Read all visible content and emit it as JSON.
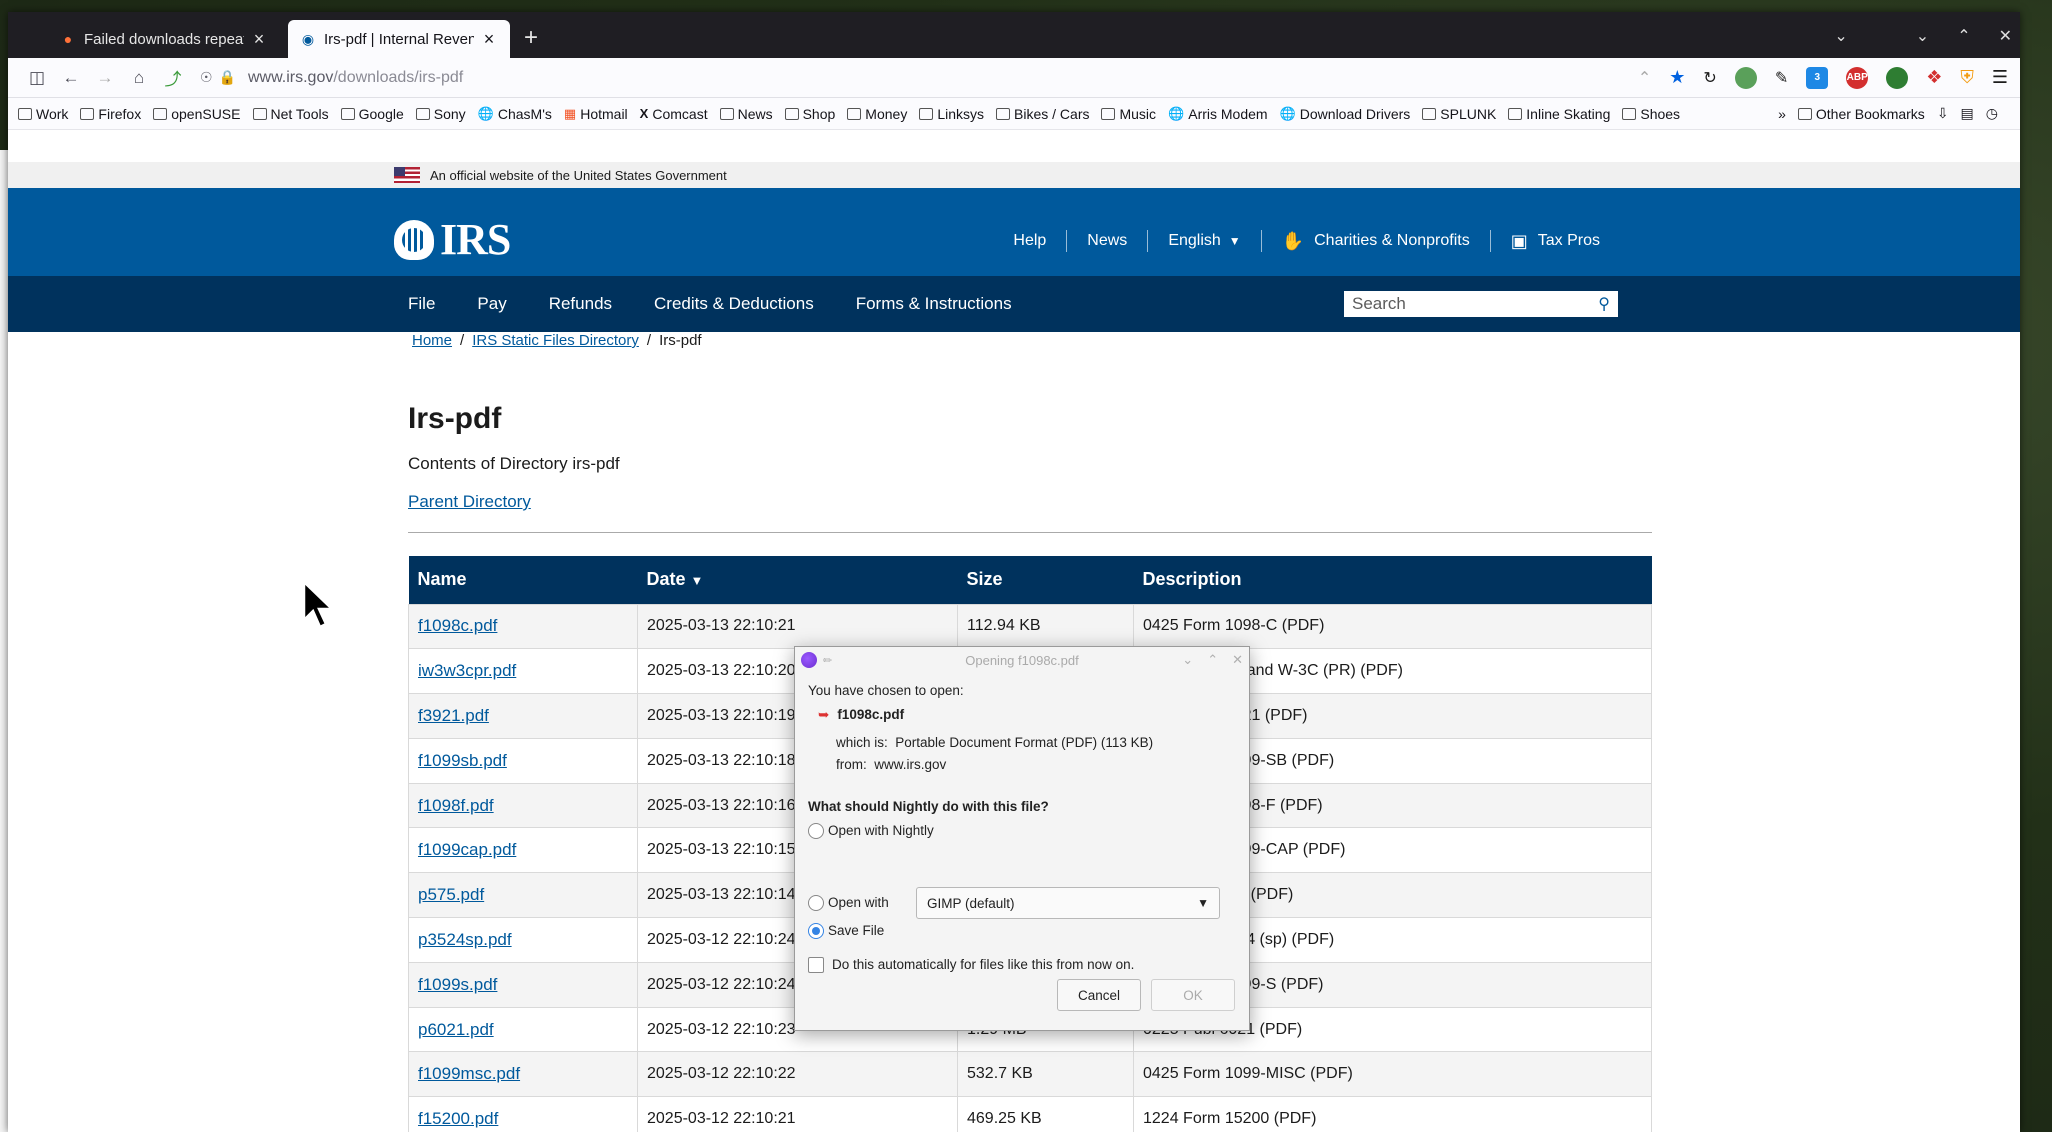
{
  "tabs": [
    {
      "title": "Failed downloads repeated",
      "active": false
    },
    {
      "title": "Irs-pdf | Internal Revenue",
      "active": true
    }
  ],
  "url": {
    "host": "www.irs.gov",
    "path": "/downloads/irs-pdf"
  },
  "extension_badge": "3",
  "bookmarks": [
    "Work",
    "Firefox",
    "openSUSE",
    "Net Tools",
    "Google",
    "Sony",
    "ChasM's",
    "Hotmail",
    "Comcast",
    "News",
    "Shop",
    "Money",
    "Linksys",
    "Bikes / Cars",
    "Music",
    "Arris Modem",
    "Download Drivers",
    "SPLUNK",
    "Inline Skating",
    "Shoes"
  ],
  "other_bookmarks": "Other Bookmarks",
  "gov_banner": "An official website of the United States Government",
  "logo_text": "IRS",
  "utility_nav": [
    "Help",
    "News",
    "English",
    "Charities & Nonprofits",
    "Tax Pros"
  ],
  "main_nav": [
    "File",
    "Pay",
    "Refunds",
    "Credits & Deductions",
    "Forms & Instructions"
  ],
  "search_placeholder": "Search",
  "breadcrumb": {
    "home": "Home",
    "static": "IRS Static Files Directory",
    "current": "Irs-pdf",
    "separator": "/"
  },
  "page": {
    "title": "Irs-pdf",
    "subtitle": "Contents of Directory irs-pdf",
    "parent_link": "Parent Directory"
  },
  "table": {
    "headers": {
      "name": "Name",
      "date": "Date",
      "size": "Size",
      "description": "Description"
    },
    "rows": [
      {
        "name": "f1098c.pdf",
        "date": "2025-03-13 22:10:21",
        "size": "112.94 KB",
        "description": "0425 Form 1098-C (PDF)"
      },
      {
        "name": "iw3w3cpr.pdf",
        "date": "2025-03-13 22:10:20",
        "size": "",
        "description": "0125 Inst W-3 and W-3C (PR) (PDF)"
      },
      {
        "name": "f3921.pdf",
        "date": "2025-03-13 22:10:19",
        "size": "",
        "description": "0425 Form 3921 (PDF)"
      },
      {
        "name": "f1099sb.pdf",
        "date": "2025-03-13 22:10:18",
        "size": "",
        "description": "0425 Form 1099-SB (PDF)"
      },
      {
        "name": "f1098f.pdf",
        "date": "2025-03-13 22:10:16",
        "size": "",
        "description": "0425 Form 1098-F (PDF)"
      },
      {
        "name": "f1099cap.pdf",
        "date": "2025-03-13 22:10:15",
        "size": "",
        "description": "0425 Form 1099-CAP (PDF)"
      },
      {
        "name": "p575.pdf",
        "date": "2025-03-13 22:10:14",
        "size": "",
        "description": "0225 Publ 575 (PDF)"
      },
      {
        "name": "p3524sp.pdf",
        "date": "2025-03-12 22:10:24",
        "size": "",
        "description": "0225 Publ 3524 (sp) (PDF)"
      },
      {
        "name": "f1099s.pdf",
        "date": "2025-03-12 22:10:24",
        "size": "",
        "description": "0425 Form 1099-S (PDF)"
      },
      {
        "name": "p6021.pdf",
        "date": "2025-03-12 22:10:23",
        "size": "1.29 MB",
        "description": "0225 Publ 6021 (PDF)"
      },
      {
        "name": "f1099msc.pdf",
        "date": "2025-03-12 22:10:22",
        "size": "532.7 KB",
        "description": "0425 Form 1099-MISC (PDF)"
      },
      {
        "name": "f15200.pdf",
        "date": "2025-03-12 22:10:21",
        "size": "469.25 KB",
        "description": "1224 Form 15200 (PDF)"
      }
    ]
  },
  "dialog": {
    "title": "Opening f1098c.pdf",
    "chosen": "You have chosen to open:",
    "filename": "f1098c.pdf",
    "which_is_label": "which is:",
    "which_is_value": "Portable Document Format (PDF) (113 KB)",
    "from_label": "from:",
    "from_value": "www.irs.gov",
    "question": "What should Nightly do with this file?",
    "opt_open_nightly": "Open with Nightly",
    "opt_open_with": "Open with",
    "app_selected": "GIMP (default)",
    "opt_save": "Save File",
    "selected_option": "Save File",
    "auto_check": "Do this automatically for files like this from now on.",
    "cancel": "Cancel",
    "ok": "OK"
  }
}
